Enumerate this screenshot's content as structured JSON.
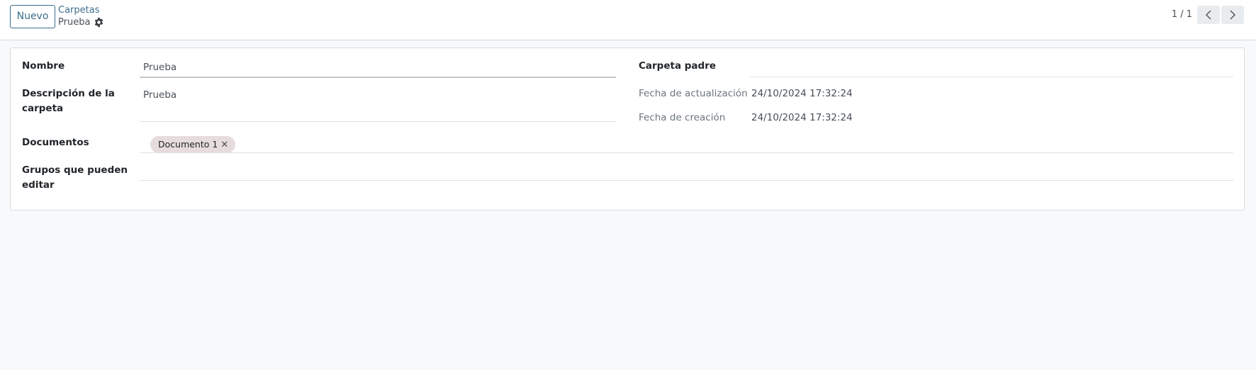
{
  "control_panel": {
    "new_button": "Nuevo",
    "breadcrumb_parent": "Carpetas",
    "breadcrumb_current": "Prueba",
    "pager_value": "1 / 1"
  },
  "form": {
    "nombre": {
      "label": "Nombre",
      "value": "Prueba"
    },
    "descripcion": {
      "label_line1": "Descripción de la",
      "label_line2": "carpeta",
      "value": "Prueba"
    },
    "documentos": {
      "label": "Documentos",
      "tags": [
        "Documento 1"
      ]
    },
    "grupos": {
      "label_line1": "Grupos que pueden",
      "label_line2": "editar",
      "value": ""
    },
    "carpeta_padre": {
      "label": "Carpeta padre",
      "value": ""
    },
    "fecha_actualizacion": {
      "label": "Fecha de actualización",
      "value": "24/10/2024 17:32:24"
    },
    "fecha_creacion": {
      "label": "Fecha de creación",
      "value": "24/10/2024 17:32:24"
    }
  },
  "colors": {
    "primary": "#3d6d8a",
    "tag_background": "#e7dcdc",
    "page_background": "#f8f9fa"
  }
}
